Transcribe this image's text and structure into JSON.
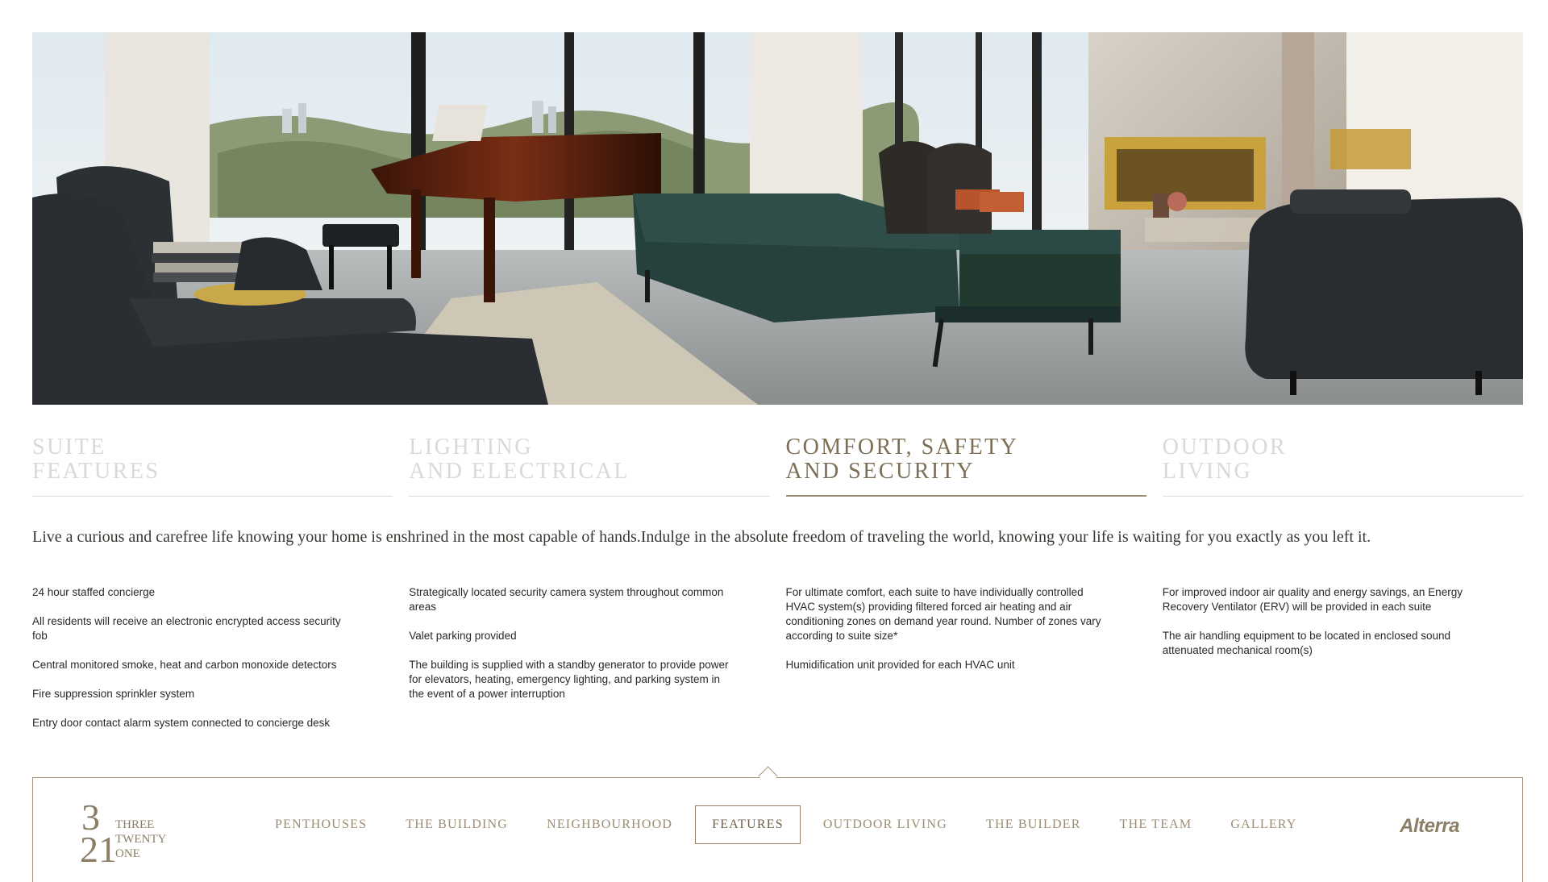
{
  "colors": {
    "accent": "#9a8a6e",
    "inactive_tab": "#d9d9d9",
    "text": "#2d2a25",
    "border": "#a3947a"
  },
  "hero": {
    "alt_icon": "living-room-photo"
  },
  "tabs": [
    {
      "line1": "SUITE",
      "line2": "FEATURES",
      "active": false
    },
    {
      "line1": "LIGHTING",
      "line2": "AND ELECTRICAL",
      "active": false
    },
    {
      "line1": "COMFORT, SAFETY",
      "line2": "AND SECURITY",
      "active": true
    },
    {
      "line1": "OUTDOOR",
      "line2": "LIVING",
      "active": false
    }
  ],
  "intro": "Live a curious and carefree life knowing your home is enshrined in the most capable of hands.Indulge in the absolute freedom of traveling the world, knowing your life is waiting  for you exactly as you left it.",
  "columns": [
    {
      "items": [
        "24 hour staffed concierge",
        "All residents will receive an electronic encrypted access security fob",
        "Central monitored smoke, heat and carbon monoxide detectors",
        "Fire suppression sprinkler system",
        "Entry door contact alarm system connected to concierge desk"
      ]
    },
    {
      "items": [
        "Strategically located security camera system throughout common areas",
        "Valet parking provided",
        "The building is supplied with a standby generator to provide power for elevators, heating, emergency lighting, and parking system in the event of a power interruption"
      ]
    },
    {
      "items": [
        "For ultimate comfort, each suite to have individually controlled HVAC system(s) providing filtered forced air heating and air conditioning zones on demand year round.  Number of zones vary according to suite size*",
        "Humidification unit provided for each HVAC unit"
      ]
    },
    {
      "items": [
        "For improved indoor air quality and energy savings, an Energy Recovery Ventilator (ERV) will be provided in each suite",
        "The air handling equipment to be located in enclosed sound attenuated mechanical room(s)"
      ]
    }
  ],
  "nav": {
    "logo": {
      "numeral_top": "3",
      "numeral_bottom": "21",
      "word1": "THREE",
      "word2": "TWENTY",
      "word3": "ONE"
    },
    "items": [
      {
        "label": "PENTHOUSES",
        "active": false
      },
      {
        "label": "THE BUILDING",
        "active": false
      },
      {
        "label": "NEIGHBOURHOOD",
        "active": false
      },
      {
        "label": "FEATURES",
        "active": true
      },
      {
        "label": "OUTDOOR LIVING",
        "active": false
      },
      {
        "label": "THE BUILDER",
        "active": false
      },
      {
        "label": "THE TEAM",
        "active": false
      },
      {
        "label": "GALLERY",
        "active": false
      }
    ],
    "brand": "Alterra"
  }
}
